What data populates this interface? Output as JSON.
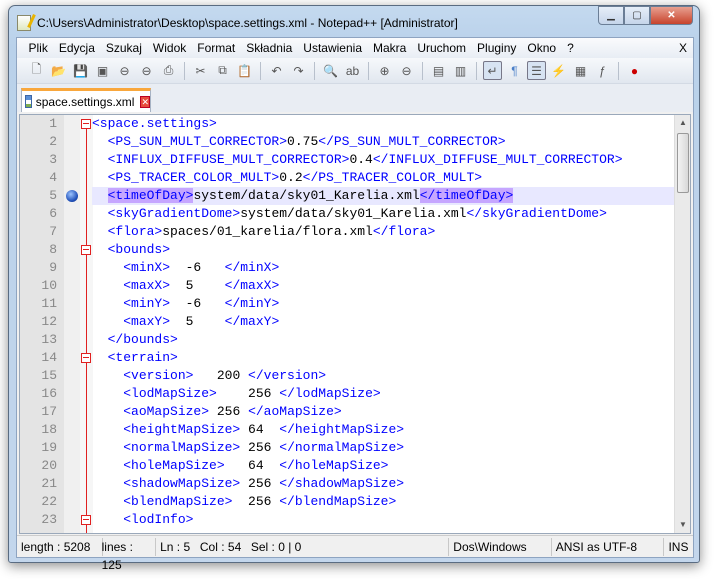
{
  "window": {
    "title": "C:\\Users\\Administrator\\Desktop\\space.settings.xml - Notepad++ [Administrator]"
  },
  "menu": [
    "Plik",
    "Edycja",
    "Szukaj",
    "Widok",
    "Format",
    "Składnia",
    "Ustawienia",
    "Makra",
    "Uruchom",
    "Pluginy",
    "Okno",
    "?"
  ],
  "menu_close": "X",
  "toolbar": [
    {
      "icon": "new-file-icon",
      "g": "🗋"
    },
    {
      "icon": "open-file-icon",
      "g": "📂"
    },
    {
      "icon": "save-icon",
      "g": "💾"
    },
    {
      "icon": "save-all-icon",
      "g": "▣"
    },
    {
      "icon": "close-icon",
      "g": "⊖"
    },
    {
      "icon": "close-all-icon",
      "g": "⊖"
    },
    {
      "icon": "print-icon",
      "g": "⎙"
    },
    {
      "sep": true
    },
    {
      "icon": "cut-icon",
      "g": "✂"
    },
    {
      "icon": "copy-icon",
      "g": "⧉"
    },
    {
      "icon": "paste-icon",
      "g": "📋"
    },
    {
      "sep": true
    },
    {
      "icon": "undo-icon",
      "g": "↶"
    },
    {
      "icon": "redo-icon",
      "g": "↷"
    },
    {
      "sep": true
    },
    {
      "icon": "find-icon",
      "g": "🔍"
    },
    {
      "icon": "replace-icon",
      "g": "ab"
    },
    {
      "sep": true
    },
    {
      "icon": "zoom-in-icon",
      "g": "⊕"
    },
    {
      "icon": "zoom-out-icon",
      "g": "⊖"
    },
    {
      "sep": true
    },
    {
      "icon": "sync-vertical-icon",
      "g": "▤"
    },
    {
      "icon": "sync-horizontal-icon",
      "g": "▥"
    },
    {
      "sep": true
    },
    {
      "icon": "word-wrap-icon",
      "g": "↵",
      "on": true
    },
    {
      "icon": "show-all-chars-icon",
      "g": "¶"
    },
    {
      "icon": "indent-guide-icon",
      "g": "☰",
      "on": true
    },
    {
      "icon": "user-lang-icon",
      "g": "⚡"
    },
    {
      "icon": "doc-map-icon",
      "g": "▦"
    },
    {
      "icon": "function-list-icon",
      "g": "ƒ"
    },
    {
      "sep": true
    },
    {
      "icon": "record-macro-icon",
      "g": "●"
    }
  ],
  "tab": {
    "label": "space.settings.xml"
  },
  "colors": {
    "tag": "#0000ff",
    "text": "#000000",
    "fold": "#e02020",
    "current_line": "#e8e8ff",
    "tag_match": "#c6a6ff"
  },
  "editor": {
    "current_line": 5,
    "lines": [
      "<space.settings>",
      "  <PS_SUN_MULT_CORRECTOR>0.75</PS_SUN_MULT_CORRECTOR>",
      "  <INFLUX_DIFFUSE_MULT_CORRECTOR>0.4</INFLUX_DIFFUSE_MULT_CORRECTOR>",
      "  <PS_TRACER_COLOR_MULT>0.2</PS_TRACER_COLOR_MULT>",
      "  <timeOfDay>system/data/sky01_Karelia.xml</timeOfDay>",
      "  <skyGradientDome>system/data/sky01_Karelia.xml</skyGradientDome>",
      "  <flora>spaces/01_karelia/flora.xml</flora>",
      "  <bounds>",
      "    <minX>  -6   </minX>",
      "    <maxX>  5    </maxX>",
      "    <minY>  -6   </minY>",
      "    <maxY>  5    </maxY>",
      "  </bounds>",
      "  <terrain>",
      "    <version>   200 </version>",
      "    <lodMapSize>    256 </lodMapSize>",
      "    <aoMapSize> 256 </aoMapSize>",
      "    <heightMapSize> 64  </heightMapSize>",
      "    <normalMapSize> 256 </normalMapSize>",
      "    <holeMapSize>   64  </holeMapSize>",
      "    <shadowMapSize> 256 </shadowMapSize>",
      "    <blendMapSize>  256 </blendMapSize>",
      "    <lodInfo>"
    ],
    "fold_lines": [
      1,
      8,
      14,
      23
    ],
    "bookmark_lines": [
      5
    ]
  },
  "status": {
    "length": "length : 5208",
    "lines": "lines : 125",
    "ln": "Ln : 5",
    "col": "Col : 54",
    "sel": "Sel : 0 | 0",
    "eol": "Dos\\Windows",
    "encoding": "ANSI as UTF-8",
    "mode": "INS"
  }
}
